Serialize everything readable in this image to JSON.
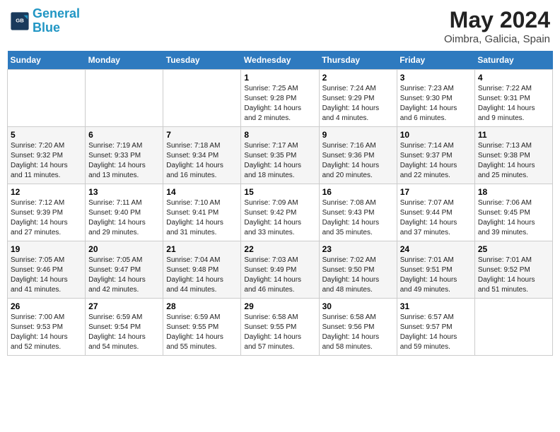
{
  "header": {
    "logo_line1": "General",
    "logo_line2": "Blue",
    "title": "May 2024",
    "subtitle": "Oimbra, Galicia, Spain"
  },
  "columns": [
    "Sunday",
    "Monday",
    "Tuesday",
    "Wednesday",
    "Thursday",
    "Friday",
    "Saturday"
  ],
  "weeks": [
    [
      {
        "day": "",
        "info": ""
      },
      {
        "day": "",
        "info": ""
      },
      {
        "day": "",
        "info": ""
      },
      {
        "day": "1",
        "info": "Sunrise: 7:25 AM\nSunset: 9:28 PM\nDaylight: 14 hours\nand 2 minutes."
      },
      {
        "day": "2",
        "info": "Sunrise: 7:24 AM\nSunset: 9:29 PM\nDaylight: 14 hours\nand 4 minutes."
      },
      {
        "day": "3",
        "info": "Sunrise: 7:23 AM\nSunset: 9:30 PM\nDaylight: 14 hours\nand 6 minutes."
      },
      {
        "day": "4",
        "info": "Sunrise: 7:22 AM\nSunset: 9:31 PM\nDaylight: 14 hours\nand 9 minutes."
      }
    ],
    [
      {
        "day": "5",
        "info": "Sunrise: 7:20 AM\nSunset: 9:32 PM\nDaylight: 14 hours\nand 11 minutes."
      },
      {
        "day": "6",
        "info": "Sunrise: 7:19 AM\nSunset: 9:33 PM\nDaylight: 14 hours\nand 13 minutes."
      },
      {
        "day": "7",
        "info": "Sunrise: 7:18 AM\nSunset: 9:34 PM\nDaylight: 14 hours\nand 16 minutes."
      },
      {
        "day": "8",
        "info": "Sunrise: 7:17 AM\nSunset: 9:35 PM\nDaylight: 14 hours\nand 18 minutes."
      },
      {
        "day": "9",
        "info": "Sunrise: 7:16 AM\nSunset: 9:36 PM\nDaylight: 14 hours\nand 20 minutes."
      },
      {
        "day": "10",
        "info": "Sunrise: 7:14 AM\nSunset: 9:37 PM\nDaylight: 14 hours\nand 22 minutes."
      },
      {
        "day": "11",
        "info": "Sunrise: 7:13 AM\nSunset: 9:38 PM\nDaylight: 14 hours\nand 25 minutes."
      }
    ],
    [
      {
        "day": "12",
        "info": "Sunrise: 7:12 AM\nSunset: 9:39 PM\nDaylight: 14 hours\nand 27 minutes."
      },
      {
        "day": "13",
        "info": "Sunrise: 7:11 AM\nSunset: 9:40 PM\nDaylight: 14 hours\nand 29 minutes."
      },
      {
        "day": "14",
        "info": "Sunrise: 7:10 AM\nSunset: 9:41 PM\nDaylight: 14 hours\nand 31 minutes."
      },
      {
        "day": "15",
        "info": "Sunrise: 7:09 AM\nSunset: 9:42 PM\nDaylight: 14 hours\nand 33 minutes."
      },
      {
        "day": "16",
        "info": "Sunrise: 7:08 AM\nSunset: 9:43 PM\nDaylight: 14 hours\nand 35 minutes."
      },
      {
        "day": "17",
        "info": "Sunrise: 7:07 AM\nSunset: 9:44 PM\nDaylight: 14 hours\nand 37 minutes."
      },
      {
        "day": "18",
        "info": "Sunrise: 7:06 AM\nSunset: 9:45 PM\nDaylight: 14 hours\nand 39 minutes."
      }
    ],
    [
      {
        "day": "19",
        "info": "Sunrise: 7:05 AM\nSunset: 9:46 PM\nDaylight: 14 hours\nand 41 minutes."
      },
      {
        "day": "20",
        "info": "Sunrise: 7:05 AM\nSunset: 9:47 PM\nDaylight: 14 hours\nand 42 minutes."
      },
      {
        "day": "21",
        "info": "Sunrise: 7:04 AM\nSunset: 9:48 PM\nDaylight: 14 hours\nand 44 minutes."
      },
      {
        "day": "22",
        "info": "Sunrise: 7:03 AM\nSunset: 9:49 PM\nDaylight: 14 hours\nand 46 minutes."
      },
      {
        "day": "23",
        "info": "Sunrise: 7:02 AM\nSunset: 9:50 PM\nDaylight: 14 hours\nand 48 minutes."
      },
      {
        "day": "24",
        "info": "Sunrise: 7:01 AM\nSunset: 9:51 PM\nDaylight: 14 hours\nand 49 minutes."
      },
      {
        "day": "25",
        "info": "Sunrise: 7:01 AM\nSunset: 9:52 PM\nDaylight: 14 hours\nand 51 minutes."
      }
    ],
    [
      {
        "day": "26",
        "info": "Sunrise: 7:00 AM\nSunset: 9:53 PM\nDaylight: 14 hours\nand 52 minutes."
      },
      {
        "day": "27",
        "info": "Sunrise: 6:59 AM\nSunset: 9:54 PM\nDaylight: 14 hours\nand 54 minutes."
      },
      {
        "day": "28",
        "info": "Sunrise: 6:59 AM\nSunset: 9:55 PM\nDaylight: 14 hours\nand 55 minutes."
      },
      {
        "day": "29",
        "info": "Sunrise: 6:58 AM\nSunset: 9:55 PM\nDaylight: 14 hours\nand 57 minutes."
      },
      {
        "day": "30",
        "info": "Sunrise: 6:58 AM\nSunset: 9:56 PM\nDaylight: 14 hours\nand 58 minutes."
      },
      {
        "day": "31",
        "info": "Sunrise: 6:57 AM\nSunset: 9:57 PM\nDaylight: 14 hours\nand 59 minutes."
      },
      {
        "day": "",
        "info": ""
      }
    ]
  ]
}
